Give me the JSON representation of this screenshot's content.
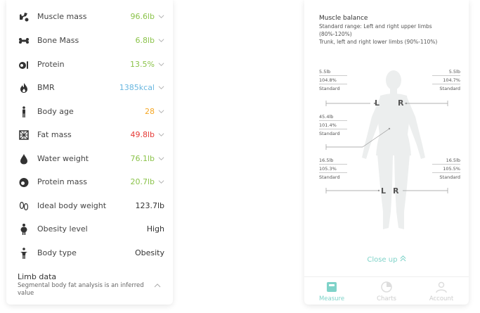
{
  "metrics": [
    {
      "icon": "muscle-icon",
      "label": "Muscle mass",
      "value": "96.6lb",
      "color": "#8bc34a",
      "arrow": true
    },
    {
      "icon": "bone-icon",
      "label": "Bone Mass",
      "value": "6.8lb",
      "color": "#8bc34a",
      "arrow": true
    },
    {
      "icon": "protein-icon",
      "label": "Protein",
      "value": "13.5%",
      "color": "#8bc34a",
      "arrow": true
    },
    {
      "icon": "flame-icon",
      "label": "BMR",
      "value": "1385kcal",
      "color": "#6ab7e0",
      "arrow": true
    },
    {
      "icon": "person-icon",
      "label": "Body age",
      "value": "28",
      "color": "#f5a623",
      "arrow": true
    },
    {
      "icon": "fat-grid-icon",
      "label": "Fat mass",
      "value": "49.8lb",
      "color": "#e53935",
      "arrow": true
    },
    {
      "icon": "water-drop-icon",
      "label": "Water weight",
      "value": "76.1lb",
      "color": "#8bc34a",
      "arrow": true
    },
    {
      "icon": "protein-mass-icon",
      "label": "Protein mass",
      "value": "20.7lb",
      "color": "#8bc34a",
      "arrow": true
    },
    {
      "icon": "footprints-icon",
      "label": "Ideal body weight",
      "value": "123.7lb",
      "color": "#333333",
      "arrow": false
    },
    {
      "icon": "obesity-person-icon",
      "label": "Obesity level",
      "value": "High",
      "color": "#333333",
      "arrow": false
    },
    {
      "icon": "body-type-icon",
      "label": "Body type",
      "value": "Obesity",
      "color": "#333333",
      "arrow": false
    }
  ],
  "limb": {
    "title": "Limb data",
    "subtitle": "Segmental body fat analysis is an inferred value"
  },
  "balance": {
    "title": "Muscle balance",
    "line1": "Standard range: Left and right upper limbs",
    "line2": "(80%-120%)",
    "line3": "Trunk, left and right lower limbs (90%-110%)",
    "left_arm": {
      "value": "5.5lb",
      "percent": "104.8%",
      "status": "Standard"
    },
    "right_arm": {
      "value": "5.5lb",
      "percent": "104.7%",
      "status": "Standard"
    },
    "trunk": {
      "value": "45.4lb",
      "percent": "101.4%",
      "status": "Standard"
    },
    "left_leg": {
      "value": "16.5lb",
      "percent": "105.3%",
      "status": "Standard"
    },
    "right_leg": {
      "value": "16.5lb",
      "percent": "105.5%",
      "status": "Standard"
    },
    "l_label": "L",
    "r_label": "R",
    "close_up": "Close up"
  },
  "tabs": [
    {
      "label": "Measure",
      "icon": "scale-icon",
      "active": true
    },
    {
      "label": "Charts",
      "icon": "chart-icon",
      "active": false
    },
    {
      "label": "Account",
      "icon": "account-icon",
      "active": false
    }
  ],
  "colors": {
    "accent": "#7fd3c9",
    "good": "#8bc34a",
    "warn": "#f5a623",
    "bad": "#e53935",
    "info": "#6ab7e0"
  }
}
